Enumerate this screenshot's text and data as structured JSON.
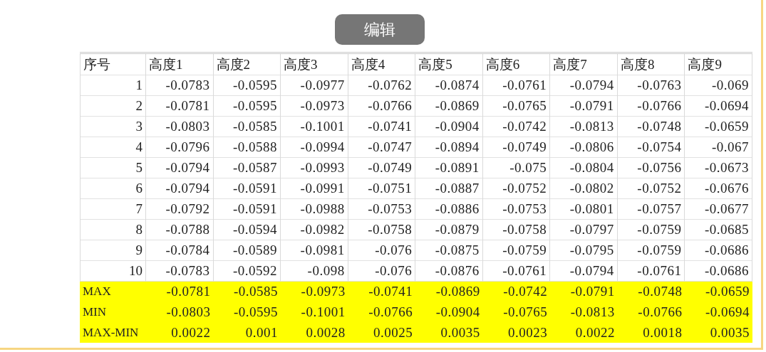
{
  "table": {
    "columns": [
      "序号",
      "高度1",
      "高度2",
      "高度3",
      "高度4",
      "高度5",
      "高度6",
      "高度7",
      "高度8",
      "高度9"
    ],
    "rows": [
      {
        "kind": "data",
        "cells": [
          "1",
          "-0.0783",
          "-0.0595",
          "-0.0977",
          "-0.0762",
          "-0.0874",
          "-0.0761",
          "-0.0794",
          "-0.0763",
          "-0.069"
        ]
      },
      {
        "kind": "data",
        "cells": [
          "2",
          "-0.0781",
          "-0.0595",
          "-0.0973",
          "-0.0766",
          "-0.0869",
          "-0.0765",
          "-0.0791",
          "-0.0766",
          "-0.0694"
        ]
      },
      {
        "kind": "data",
        "cells": [
          "3",
          "-0.0803",
          "-0.0585",
          "-0.1001",
          "-0.0741",
          "-0.0904",
          "-0.0742",
          "-0.0813",
          "-0.0748",
          "-0.0659"
        ]
      },
      {
        "kind": "data",
        "cells": [
          "4",
          "-0.0796",
          "-0.0588",
          "-0.0994",
          "-0.0747",
          "-0.0894",
          "-0.0749",
          "-0.0806",
          "-0.0754",
          "-0.067"
        ]
      },
      {
        "kind": "data",
        "cells": [
          "5",
          "-0.0794",
          "-0.0587",
          "-0.0993",
          "-0.0749",
          "-0.0891",
          "-0.075",
          "-0.0804",
          "-0.0756",
          "-0.0673"
        ]
      },
      {
        "kind": "data",
        "cells": [
          "6",
          "-0.0794",
          "-0.0591",
          "-0.0991",
          "-0.0751",
          "-0.0887",
          "-0.0752",
          "-0.0802",
          "-0.0752",
          "-0.0676"
        ]
      },
      {
        "kind": "data",
        "cells": [
          "7",
          "-0.0792",
          "-0.0591",
          "-0.0988",
          "-0.0753",
          "-0.0886",
          "-0.0753",
          "-0.0801",
          "-0.0757",
          "-0.0677"
        ]
      },
      {
        "kind": "data",
        "cells": [
          "8",
          "-0.0788",
          "-0.0594",
          "-0.0982",
          "-0.0758",
          "-0.0879",
          "-0.0758",
          "-0.0797",
          "-0.0759",
          "-0.0685"
        ]
      },
      {
        "kind": "data",
        "cells": [
          "9",
          "-0.0784",
          "-0.0589",
          "-0.0981",
          "-0.076",
          "-0.0875",
          "-0.0759",
          "-0.0795",
          "-0.0759",
          "-0.0686"
        ]
      },
      {
        "kind": "data",
        "cells": [
          "10",
          "-0.0783",
          "-0.0592",
          "-0.098",
          "-0.076",
          "-0.0876",
          "-0.0761",
          "-0.0794",
          "-0.0761",
          "-0.0686"
        ]
      },
      {
        "kind": "summary",
        "cells": [
          "MAX",
          "-0.0781",
          "-0.0585",
          "-0.0973",
          "-0.0741",
          "-0.0869",
          "-0.0742",
          "-0.0791",
          "-0.0748",
          "-0.0659"
        ]
      },
      {
        "kind": "summary",
        "cells": [
          "MIN",
          "-0.0803",
          "-0.0595",
          "-0.1001",
          "-0.0766",
          "-0.0904",
          "-0.0765",
          "-0.0813",
          "-0.0766",
          "-0.0694"
        ]
      },
      {
        "kind": "summary",
        "cells": [
          "MAX-MIN",
          "0.0022",
          "0.001",
          "0.0028",
          "0.0025",
          "0.0035",
          "0.0023",
          "0.0022",
          "0.0018",
          "0.0035"
        ]
      }
    ]
  },
  "overlay_button": {
    "label": "编辑"
  }
}
